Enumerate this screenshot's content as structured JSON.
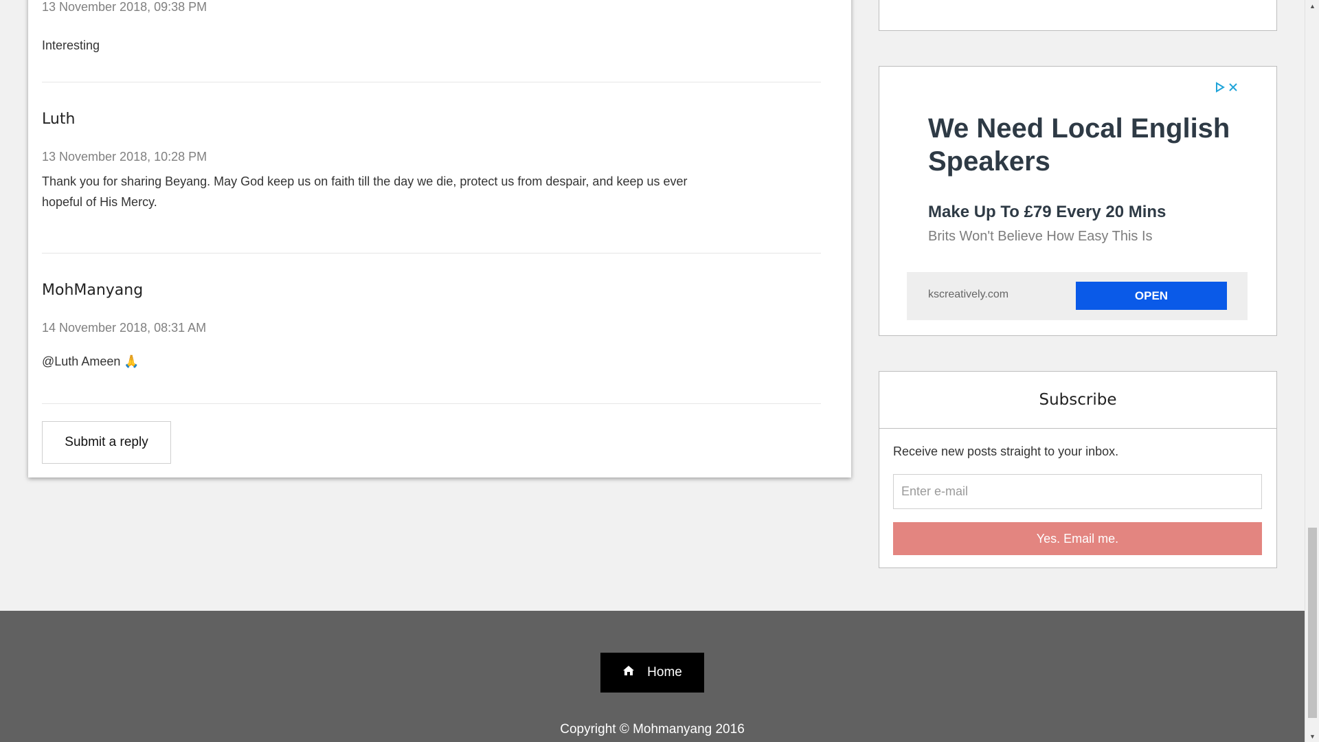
{
  "comments": [
    {
      "date": "13 November 2018, 09:38 PM",
      "body": "Interesting"
    },
    {
      "author": "Luth",
      "date": "13 November 2018, 10:28 PM",
      "body": "Thank you for sharing Beyang. May God keep us on faith till the day we die, protect us from despair, and keep us ever hopeful of His Mercy."
    },
    {
      "author": "MohManyang",
      "date": "14 November 2018, 08:31 AM",
      "body": "@Luth Ameen 🙏"
    }
  ],
  "reply_button": "Submit a reply",
  "ad": {
    "headline": "We Need Local English Speakers",
    "subheadline": "Make Up To £79 Every 20 Mins",
    "description": "Brits Won't Believe How Easy This Is",
    "domain": "kscreatively.com",
    "cta": "OPEN",
    "cta_color": "#0a5ae8",
    "choices_icon": "adchoices-play-icon",
    "close_icon": "close-icon"
  },
  "subscribe": {
    "title": "Subscribe",
    "text": "Receive new posts straight to your inbox.",
    "email_placeholder": "Enter e-mail",
    "button": "Yes. Email me.",
    "button_color": "#e38580"
  },
  "footer": {
    "home_label": "Home",
    "home_icon": "home-icon",
    "copyright": "Copyright © Mohmanyang 2016",
    "background": "#616161"
  }
}
